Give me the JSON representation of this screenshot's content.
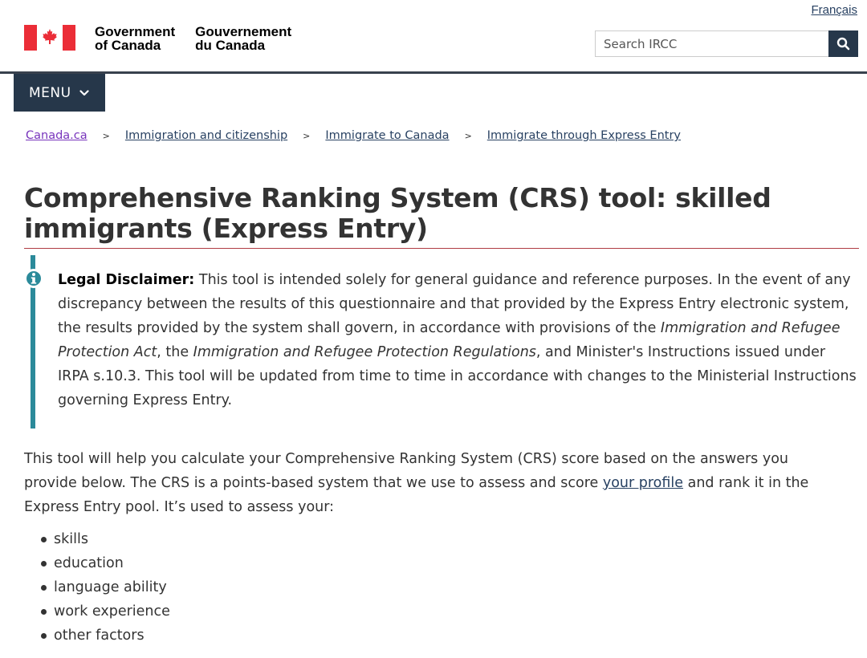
{
  "header": {
    "language_link": "Français",
    "signature_en_line1": "Government",
    "signature_en_line2": "of Canada",
    "signature_fr_line1": "Gouvernement",
    "signature_fr_line2": "du Canada",
    "search_placeholder": "Search IRCC",
    "search_icon": "search-icon",
    "menu_label": "MENU",
    "brand_color": "#eb2d37",
    "nav_color": "#26374a"
  },
  "breadcrumbs": [
    {
      "label": "Canada.ca"
    },
    {
      "label": "Immigration and citizenship"
    },
    {
      "label": "Immigrate to Canada"
    },
    {
      "label": "Immigrate through Express Entry"
    }
  ],
  "breadcrumb_separator": ">",
  "page": {
    "title": "Comprehensive Ranking System (CRS) tool: skilled immigrants (Express Entry)"
  },
  "disclaimer": {
    "label": "Legal Disclaimer:",
    "text_1": " This tool is intended solely for general guidance and reference purposes. In the event of any discrepancy between the results of this questionnaire and that provided by the Express Entry electronic system, the results provided by the system shall govern, in accordance with provisions of the ",
    "act": "Immigration and Refugee Protection Act",
    "text_2": ", the ",
    "regulations": "Immigration and Refugee Protection Regulations",
    "text_3": ", and Minister's Instructions issued under IRPA s.10.3. This tool will be updated from time to time in accordance with changes to the Ministerial Instructions governing Express Entry.",
    "accent_color": "#2b8a9a"
  },
  "intro": {
    "text_1": "This tool will help you calculate your Comprehensive Ranking System (CRS) score based on the answers you provide below. The CRS is a points-based system that we use to assess and score ",
    "link": "your profile",
    "text_2": " and rank it in the Express Entry pool. It’s used to assess your:"
  },
  "factors": [
    "skills",
    "education",
    "language ability",
    "work experience",
    "other factors"
  ]
}
